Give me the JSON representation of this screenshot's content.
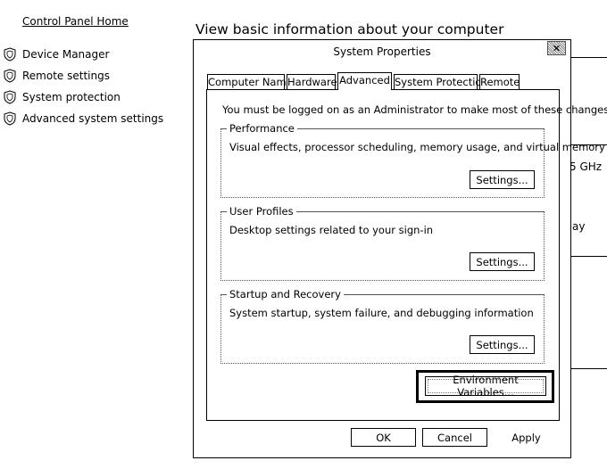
{
  "sidebar": {
    "home_link": "Control Panel Home",
    "items": [
      {
        "label": "Device Manager",
        "icon": "shield-icon"
      },
      {
        "label": "Remote settings",
        "icon": "shield-icon"
      },
      {
        "label": "System protection",
        "icon": "shield-icon"
      },
      {
        "label": "Advanced system settings",
        "icon": "shield-icon"
      }
    ]
  },
  "background": {
    "title": "View basic information about your computer",
    "partial_texts": [
      "5 GHz",
      "ay"
    ]
  },
  "dialog": {
    "title": "System Properties",
    "tabs": [
      {
        "label": "Computer Name"
      },
      {
        "label": "Hardware"
      },
      {
        "label": "Advanced",
        "active": true
      },
      {
        "label": "System Protection"
      },
      {
        "label": "Remote"
      }
    ],
    "admin_note": "You must be logged on as an Administrator to make most of these changes.",
    "groups": [
      {
        "legend": "Performance",
        "description": "Visual effects, processor scheduling, memory usage, and virtual memory",
        "button": "Settings..."
      },
      {
        "legend": "User Profiles",
        "description": "Desktop settings related to your sign-in",
        "button": "Settings..."
      },
      {
        "legend": "Startup and Recovery",
        "description": "System startup, system failure, and debugging information",
        "button": "Settings..."
      }
    ],
    "env_button": "Environment Variables...",
    "ok": "OK",
    "cancel": "Cancel",
    "apply": "Apply"
  }
}
